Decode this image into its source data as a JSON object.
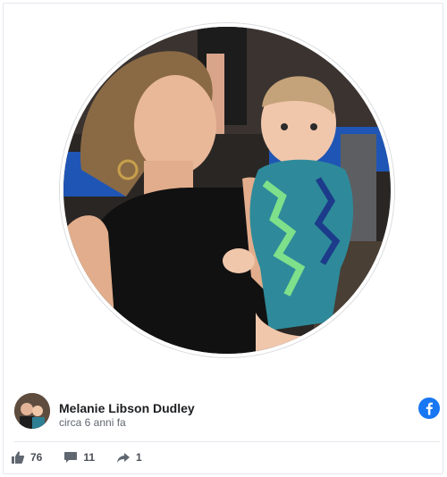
{
  "post": {
    "author_name": "Melanie Libson Dudley",
    "timestamp": "circa 6 anni fa",
    "platform_icon": "facebook-icon",
    "brand_color": "#1877f2",
    "photo_description_icon": "profile-photo"
  },
  "stats": {
    "likes": "76",
    "comments": "11",
    "shares": "1"
  },
  "icons": {
    "like": "thumbs-up-icon",
    "comment": "comment-icon",
    "share": "share-arrow-icon"
  }
}
